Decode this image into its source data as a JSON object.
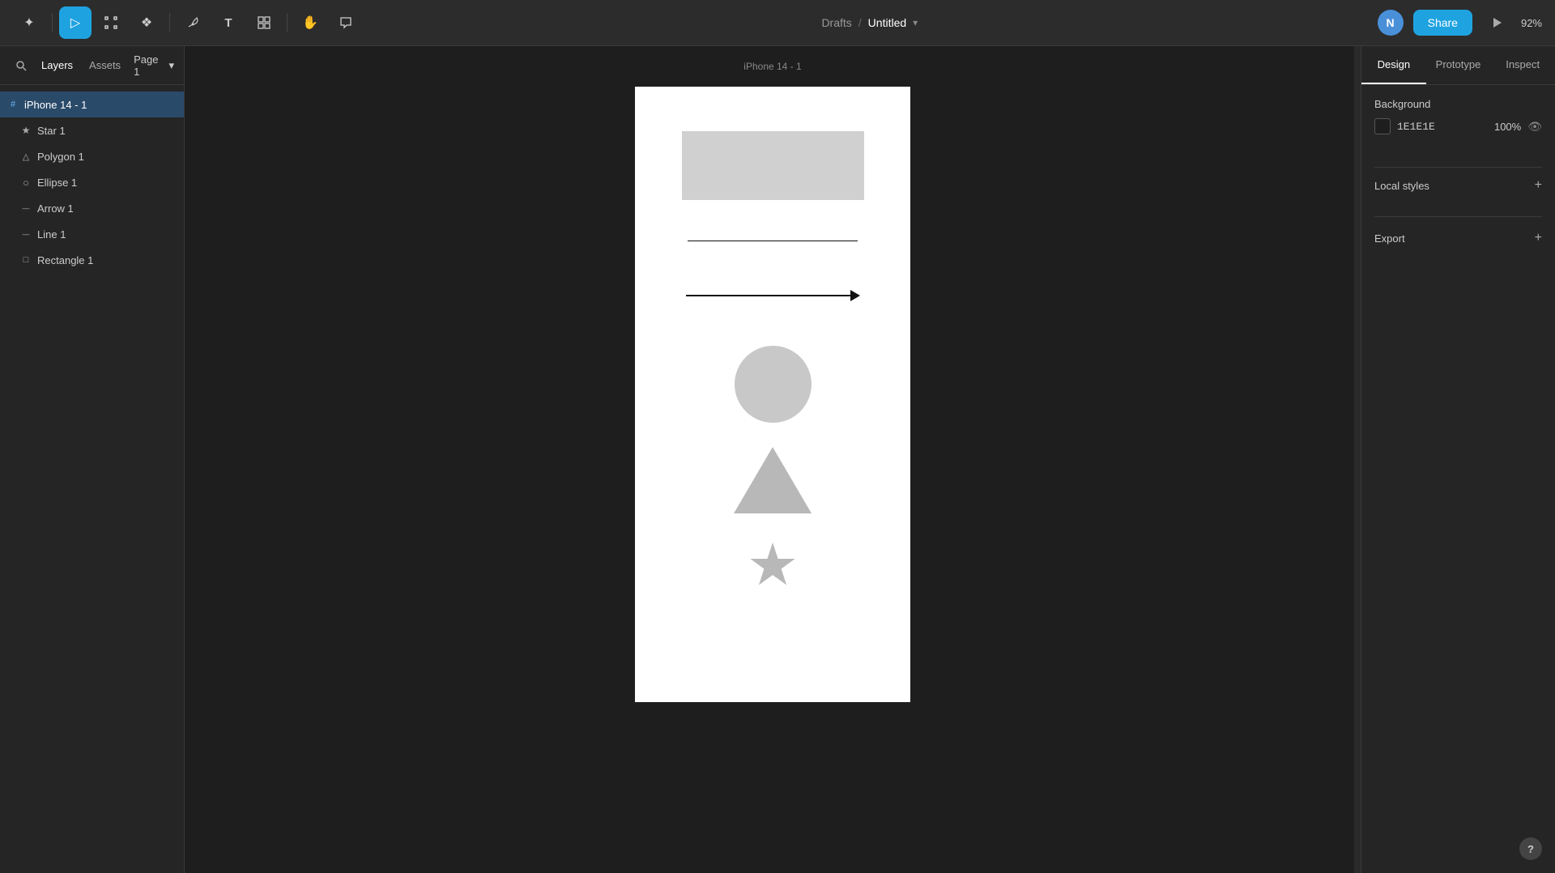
{
  "topbar": {
    "drafts_label": "Drafts",
    "slash": "/",
    "title": "Untitled",
    "chevron": "▾",
    "zoom": "92%",
    "share_label": "Share",
    "avatar_letter": "N",
    "tools": [
      {
        "name": "figma-menu",
        "icon": "✦",
        "active": false
      },
      {
        "name": "move-tool",
        "icon": "▷",
        "active": true
      },
      {
        "name": "frame-tool",
        "icon": "#",
        "active": false
      },
      {
        "name": "component-tool",
        "icon": "❖",
        "active": false
      },
      {
        "name": "pen-tool",
        "icon": "✒",
        "active": false
      },
      {
        "name": "text-tool",
        "icon": "T",
        "active": false
      },
      {
        "name": "assets-tool",
        "icon": "◫",
        "active": false
      },
      {
        "name": "hand-tool",
        "icon": "✋",
        "active": false
      },
      {
        "name": "comment-tool",
        "icon": "💬",
        "active": false
      }
    ]
  },
  "left_panel": {
    "search_icon": "🔍",
    "tabs": [
      {
        "label": "Layers",
        "active": true
      },
      {
        "label": "Assets",
        "active": false
      }
    ],
    "page_label": "Page 1",
    "layers": [
      {
        "label": "iPhone 14 - 1",
        "icon": "#",
        "level": 0,
        "selected": true
      },
      {
        "label": "Star 1",
        "icon": "★",
        "level": 1
      },
      {
        "label": "Polygon 1",
        "icon": "△",
        "level": 1
      },
      {
        "label": "Ellipse 1",
        "icon": "○",
        "level": 1
      },
      {
        "label": "Arrow 1",
        "icon": "—",
        "level": 1
      },
      {
        "label": "Line 1",
        "icon": "—",
        "level": 1
      },
      {
        "label": "Rectangle 1",
        "icon": "□",
        "level": 1
      }
    ]
  },
  "canvas": {
    "frame_label": "iPhone 14 - 1"
  },
  "right_panel": {
    "tabs": [
      {
        "label": "Design",
        "active": true
      },
      {
        "label": "Prototype",
        "active": false
      },
      {
        "label": "Inspect",
        "active": false
      }
    ],
    "background": {
      "section_label": "Background",
      "color_hex": "1E1E1E",
      "opacity": "100%"
    },
    "local_styles": {
      "section_label": "Local styles",
      "add_icon": "+"
    },
    "export": {
      "section_label": "Export",
      "add_icon": "+"
    }
  },
  "help_label": "?"
}
